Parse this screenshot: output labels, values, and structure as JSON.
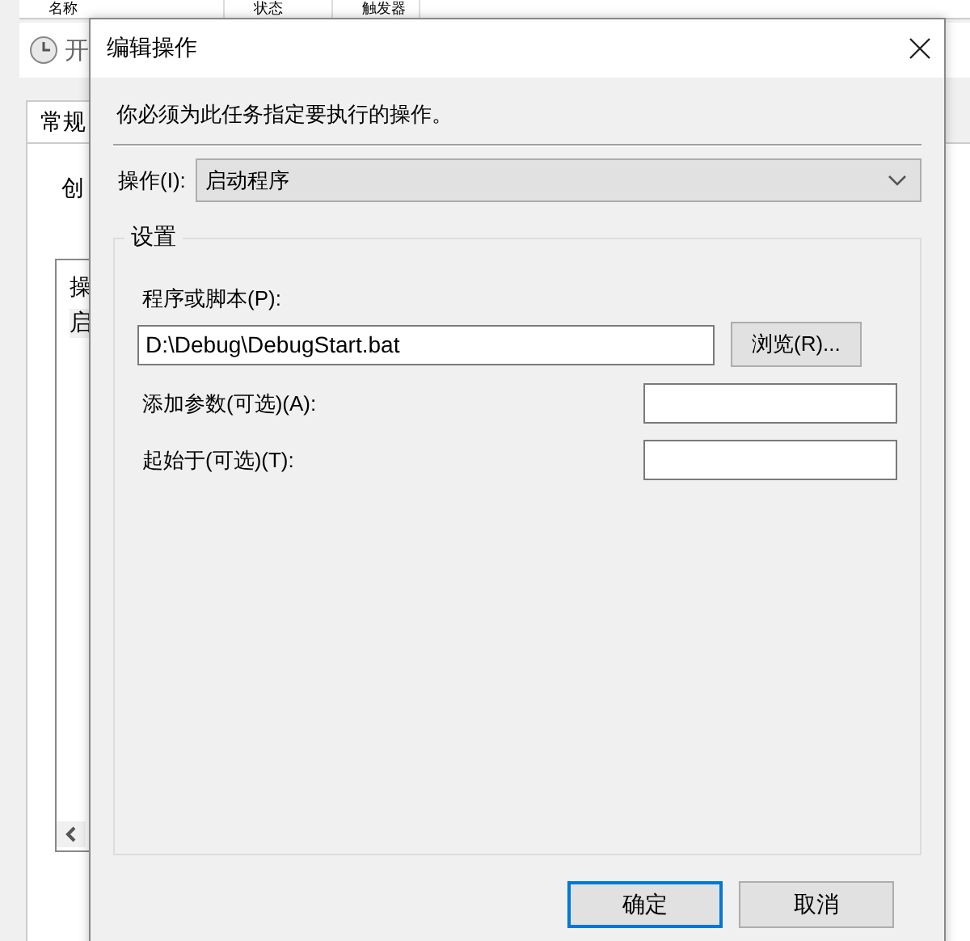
{
  "background_window": {
    "columns": [
      "名称",
      "状态",
      "触发器"
    ],
    "title": "开",
    "tab": "常规",
    "label": "创",
    "list_items": [
      "操",
      "启"
    ]
  },
  "dialog": {
    "title": "编辑操作",
    "instruction": "你必须为此任务指定要执行的操作。",
    "action": {
      "label": "操作(I):",
      "value": "启动程序"
    },
    "settings": {
      "legend": "设置",
      "program_label": "程序或脚本(P):",
      "program_value": "D:\\Debug\\DebugStart.bat",
      "browse": "浏览(R)...",
      "fields": [
        {
          "label": "添加参数(可选)(A):"
        },
        {
          "label": "起始于(可选)(T):"
        }
      ]
    },
    "buttons": [
      {
        "label": "确定",
        "default": true
      },
      {
        "label": "取消",
        "default": false
      }
    ]
  }
}
